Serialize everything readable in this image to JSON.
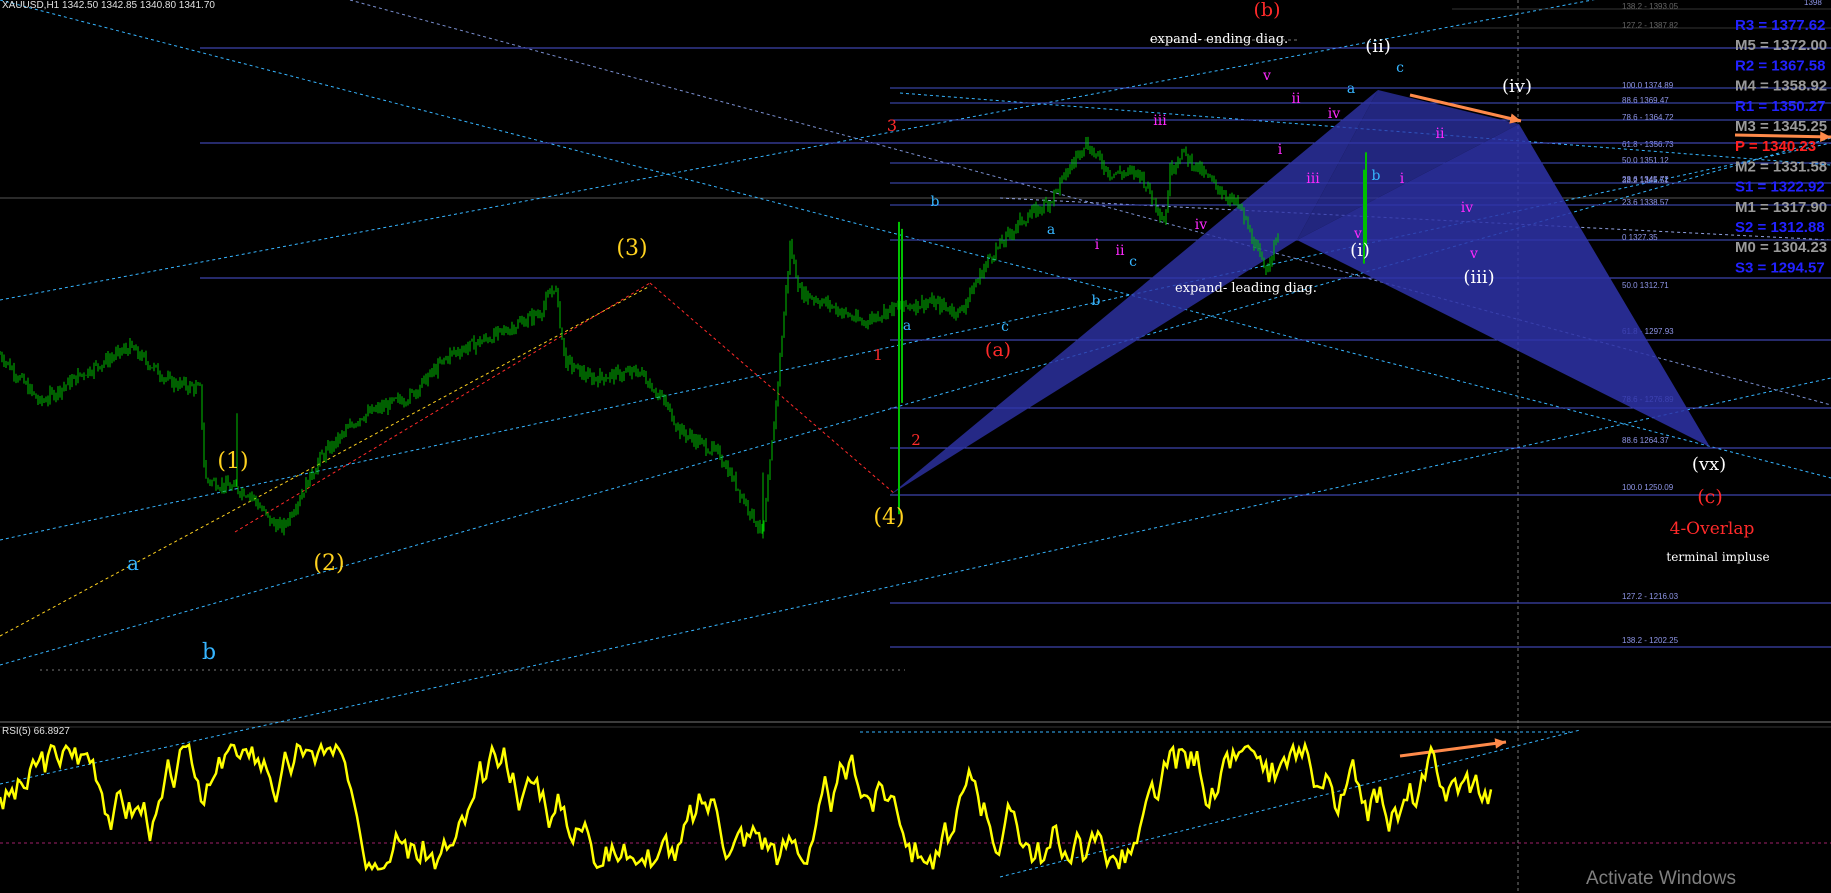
{
  "header": {
    "symbol": "XAUUSD,H1",
    "ohlc": "1342.50 1342.85 1340.80 1341.70"
  },
  "rsi": {
    "label": "RSI(5) 66.8927"
  },
  "watermark": "Activate Windows",
  "colors": {
    "background": "#000000",
    "candles": "#00c000",
    "rsi": "#ffff00",
    "wave_yellow": "#ffd21f",
    "wave_red": "#ff2a2a",
    "wave_cyan": "#36b5ff",
    "wave_magenta": "#ff29ff",
    "wave_white": "#ffffff",
    "pattern_fill": "#2e33a8",
    "fib_line": "#4b55d6",
    "arrow": "#ff8a4a"
  },
  "chart_data": [
    {
      "type": "candlestick",
      "symbol": "XAUUSD",
      "timeframe": "H1",
      "ylim": [
        1198,
        1398
      ],
      "close_path": [
        [
          0,
          1304
        ],
        [
          40,
          1290
        ],
        [
          80,
          1298
        ],
        [
          130,
          1306
        ],
        [
          170,
          1296
        ],
        [
          200,
          1294
        ],
        [
          205,
          1268
        ],
        [
          250,
          1264
        ],
        [
          270,
          1256
        ],
        [
          283,
          1254
        ],
        [
          320,
          1274
        ],
        [
          360,
          1286
        ],
        [
          410,
          1292
        ],
        [
          450,
          1304
        ],
        [
          500,
          1310
        ],
        [
          540,
          1316
        ],
        [
          555,
          1324
        ],
        [
          565,
          1302
        ],
        [
          590,
          1297
        ],
        [
          640,
          1299
        ],
        [
          665,
          1290
        ],
        [
          680,
          1282
        ],
        [
          720,
          1275
        ],
        [
          763,
          1252
        ],
        [
          775,
          1287
        ],
        [
          790,
          1335
        ],
        [
          800,
          1322
        ],
        [
          830,
          1318
        ],
        [
          862,
          1313
        ],
        [
          890,
          1317
        ],
        [
          930,
          1319
        ],
        [
          960,
          1316
        ],
        [
          990,
          1332
        ],
        [
          1020,
          1342
        ],
        [
          1050,
          1348
        ],
        [
          1085,
          1365
        ],
        [
          1110,
          1356
        ],
        [
          1140,
          1356
        ],
        [
          1165,
          1342
        ],
        [
          1170,
          1357
        ],
        [
          1182,
          1362
        ],
        [
          1210,
          1354
        ],
        [
          1240,
          1346
        ],
        [
          1265,
          1328
        ],
        [
          1278,
          1338
        ]
      ],
      "fib_levels": [
        {
          "label": "138.2 - 1393.05"
        },
        {
          "label": "127.2 - 1387.82"
        },
        {
          "label": "100.0 1374.89"
        },
        {
          "label": "88.6 1369.47"
        },
        {
          "label": "78.6 - 1364.72"
        },
        {
          "label": "61.8 - 1356.73"
        },
        {
          "label": "50.0 1351.12"
        },
        {
          "label": "38.2 1345.51"
        },
        {
          "label": "23.6 1338.57"
        },
        {
          "label": "0 1327.35"
        },
        {
          "label": "50.0 1312.71"
        },
        {
          "label": "61.8 - 1297.93"
        },
        {
          "label": "78.6 - 1276.89"
        },
        {
          "label": "88.6 1264.37"
        },
        {
          "label": "100.0 1250.09"
        },
        {
          "label": "127.2 - 1216.03"
        },
        {
          "label": "138.2 - 1202.25"
        },
        {
          "label": "23.6 1345.72"
        },
        {
          "label": "1398"
        }
      ],
      "pivots": [
        {
          "label": "R3 = 1377.62",
          "color": "#2222ff"
        },
        {
          "label": "M5 = 1372.00",
          "color": "#9a9a9a"
        },
        {
          "label": "R2 = 1367.58",
          "color": "#2222ff"
        },
        {
          "label": "M4 = 1358.92",
          "color": "#9a9a9a"
        },
        {
          "label": "R1 = 1350.27",
          "color": "#2222ff"
        },
        {
          "label": "M3 = 1345.25",
          "color": "#9a9a9a"
        },
        {
          "label": "P  = 1340.23",
          "color": "#ff2020"
        },
        {
          "label": "M2 = 1331.58",
          "color": "#9a9a9a"
        },
        {
          "label": "S1 = 1322.92",
          "color": "#2222ff"
        },
        {
          "label": "M1 = 1317.90",
          "color": "#9a9a9a"
        },
        {
          "label": "S2 = 1312.88",
          "color": "#2222ff"
        },
        {
          "label": "M0 = 1304.23",
          "color": "#9a9a9a"
        },
        {
          "label": "S3 = 1294.57",
          "color": "#2222ff"
        }
      ],
      "wave_labels": [
        {
          "text": "(1)",
          "color": "#ffd21f"
        },
        {
          "text": "(2)",
          "color": "#ffd21f"
        },
        {
          "text": "(3)",
          "color": "#ffd21f"
        },
        {
          "text": "(4)",
          "color": "#ffd21f"
        },
        {
          "text": "a",
          "color": "#36b5ff"
        },
        {
          "text": "b",
          "color": "#36b5ff"
        },
        {
          "text": "3",
          "color": "#ff2a2a"
        },
        {
          "text": "1",
          "color": "#ff2a2a"
        },
        {
          "text": "2",
          "color": "#ff2a2a"
        },
        {
          "text": "(a)",
          "color": "#ff2a2a"
        },
        {
          "text": "(b)",
          "color": "#ff2a2a"
        },
        {
          "text": "(c)",
          "color": "#ff2a2a"
        },
        {
          "text": "a",
          "color": "#36b5ff"
        },
        {
          "text": "b",
          "color": "#36b5ff"
        },
        {
          "text": "c",
          "color": "#36b5ff"
        },
        {
          "text": "a",
          "color": "#36b5ff"
        },
        {
          "text": "b",
          "color": "#36b5ff"
        },
        {
          "text": "c",
          "color": "#36b5ff"
        },
        {
          "text": "a",
          "color": "#36b5ff"
        },
        {
          "text": "b",
          "color": "#36b5ff"
        },
        {
          "text": "c",
          "color": "#36b5ff"
        },
        {
          "text": "i",
          "color": "#ff29ff"
        },
        {
          "text": "ii",
          "color": "#ff29ff"
        },
        {
          "text": "iii",
          "color": "#ff29ff"
        },
        {
          "text": "iv",
          "color": "#ff29ff"
        },
        {
          "text": "v",
          "color": "#ff29ff"
        },
        {
          "text": "i",
          "color": "#ff29ff"
        },
        {
          "text": "ii",
          "color": "#ff29ff"
        },
        {
          "text": "iii",
          "color": "#ff29ff"
        },
        {
          "text": "iv",
          "color": "#ff29ff"
        },
        {
          "text": "v",
          "color": "#ff29ff"
        },
        {
          "text": "i",
          "color": "#ff29ff"
        },
        {
          "text": "ii",
          "color": "#ff29ff"
        },
        {
          "text": "iv",
          "color": "#ff29ff"
        },
        {
          "text": "v",
          "color": "#ff29ff"
        },
        {
          "text": "(i)",
          "color": "#ffffff"
        },
        {
          "text": "(ii)",
          "color": "#ffffff"
        },
        {
          "text": "(iii)",
          "color": "#ffffff"
        },
        {
          "text": "(iv)",
          "color": "#ffffff"
        },
        {
          "text": "(vx)",
          "color": "#ffffff"
        }
      ],
      "annotations": [
        {
          "text": "expand- ending diag.",
          "color": "#ffffff"
        },
        {
          "text": "expand- leading diag.",
          "color": "#ffffff"
        },
        {
          "text": "4-Overlap",
          "color": "#ff2a2a"
        },
        {
          "text": "terminal impluse",
          "color": "#ffffff"
        }
      ]
    },
    {
      "type": "line",
      "name": "RSI(5)",
      "last_value": 66.8927,
      "ylim": [
        0,
        100
      ]
    }
  ]
}
